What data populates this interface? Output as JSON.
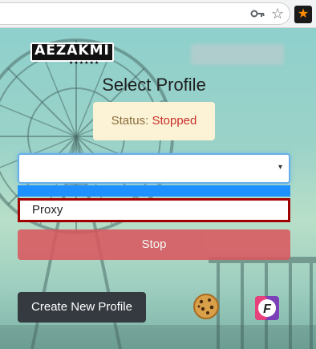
{
  "browser": {
    "icons": [
      "key-icon",
      "star-icon",
      "extension-icon"
    ],
    "star_glyph": "☆",
    "extension_glyph": "★",
    "extension_color": "#ff8c00"
  },
  "popup": {
    "logo_text": "AEZAKMI",
    "logo_stars": "★★★★★★",
    "title": "Select Profile",
    "status": {
      "label": "Status:",
      "value": "Stopped",
      "label_color": "#8a6d3b",
      "value_color": "#c9302c",
      "background": "#fcf3d6"
    },
    "profile_select": {
      "selected_value": "",
      "caret": "▾",
      "border_color": "#66afe9"
    },
    "dropdown_options": [
      {
        "label": "",
        "highlighted": true,
        "highlight_color": "#1e90ff"
      },
      {
        "label": "Proxy",
        "highlighted": false,
        "outline_color": "#a00000"
      }
    ],
    "stop_button": {
      "label": "Stop",
      "color": "#d9585f"
    },
    "create_button": {
      "label": "Create New Profile",
      "color": "#343a40"
    },
    "footer_icons": [
      "cookie-icon",
      "f-letter-icon"
    ],
    "f_icon_letter": "F"
  }
}
